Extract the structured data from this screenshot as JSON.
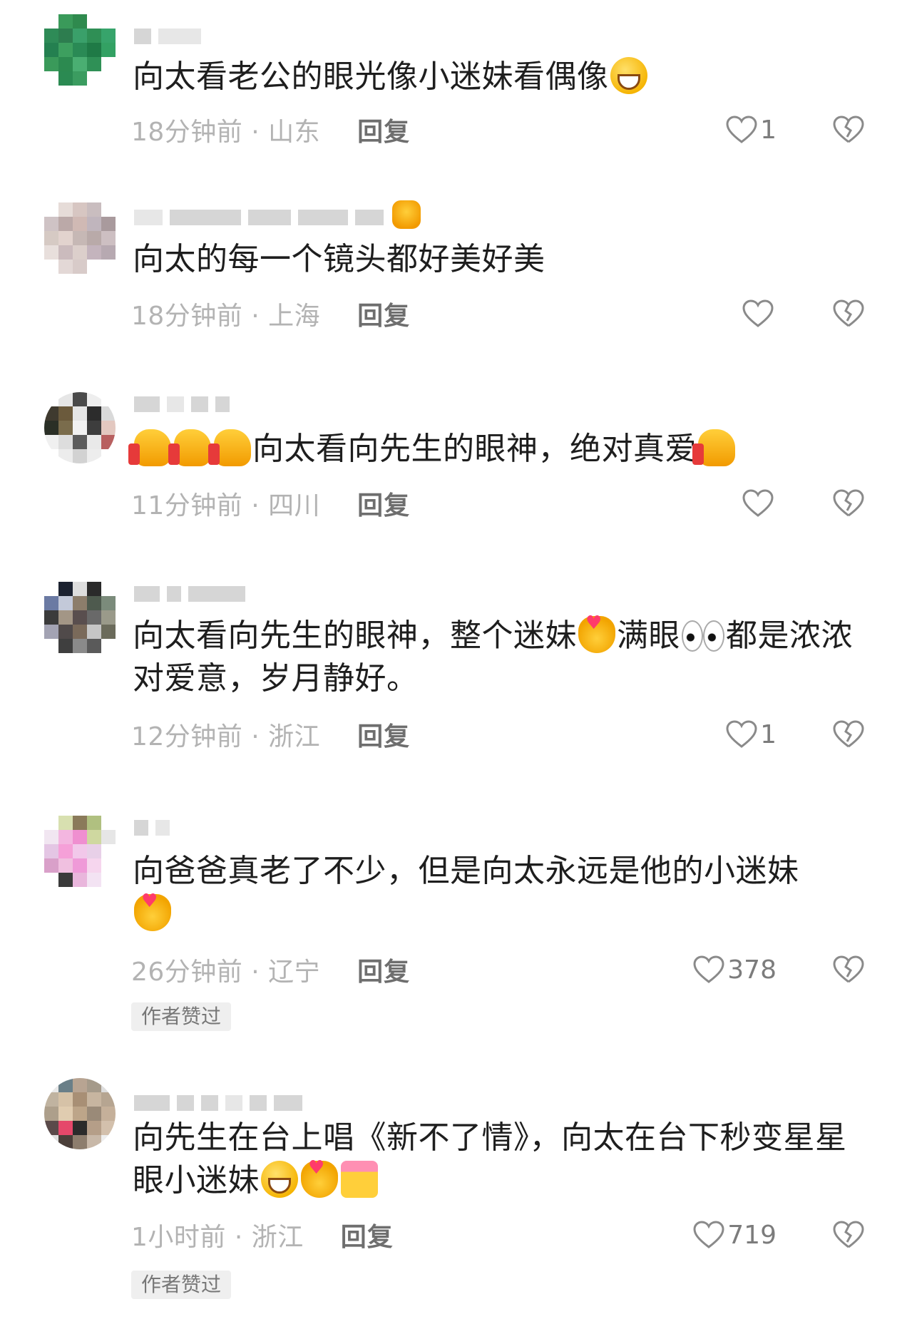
{
  "comments": [
    {
      "text_before": "向太看老公的眼光像小迷妹看偶像",
      "emoji_after": "grin-emoji",
      "time_location": "18分钟前 · 山东",
      "reply_label": "回复",
      "like_count": "1"
    },
    {
      "text_before": "向太的每一个镜头都好美好美",
      "time_location": "18分钟前 · 上海",
      "reply_label": "回复",
      "like_count": ""
    },
    {
      "text_before": "向太看向先生的眼神，绝对真爱",
      "emoji_prefix": [
        "thumbs-up-emoji",
        "thumbs-up-emoji",
        "thumbs-up-emoji"
      ],
      "emoji_after": "thumbs-up-emoji",
      "time_location": "11分钟前 · 四川",
      "reply_label": "回复",
      "like_count": ""
    },
    {
      "text_part1": "向太看向先生的眼神，整个迷妹",
      "text_part2": "满眼",
      "text_part3": "都是浓浓对爱意，岁月静好。",
      "time_location": "12分钟前 · 浙江",
      "reply_label": "回复",
      "like_count": "1"
    },
    {
      "text_before": "向爸爸真老了不少，但是向太永远是他的小迷妹",
      "time_location": "26分钟前 · 辽宁",
      "reply_label": "回复",
      "like_count": "378",
      "badge": "作者赞过"
    },
    {
      "text_before": "向先生在台上唱《新不了情》，向太在台下秒变星星眼小迷妹",
      "time_location": "1小时前 · 浙江",
      "reply_label": "回复",
      "like_count": "719",
      "badge": "作者赞过"
    }
  ],
  "icons": {
    "like": "heart-outline-icon",
    "dislike": "broken-heart-icon"
  },
  "colors": {
    "text": "#1e1e1e",
    "meta": "#b3b3b3",
    "reply": "#6e6e6e",
    "icon": "#8a8a8a",
    "badge_bg": "#efefef"
  }
}
